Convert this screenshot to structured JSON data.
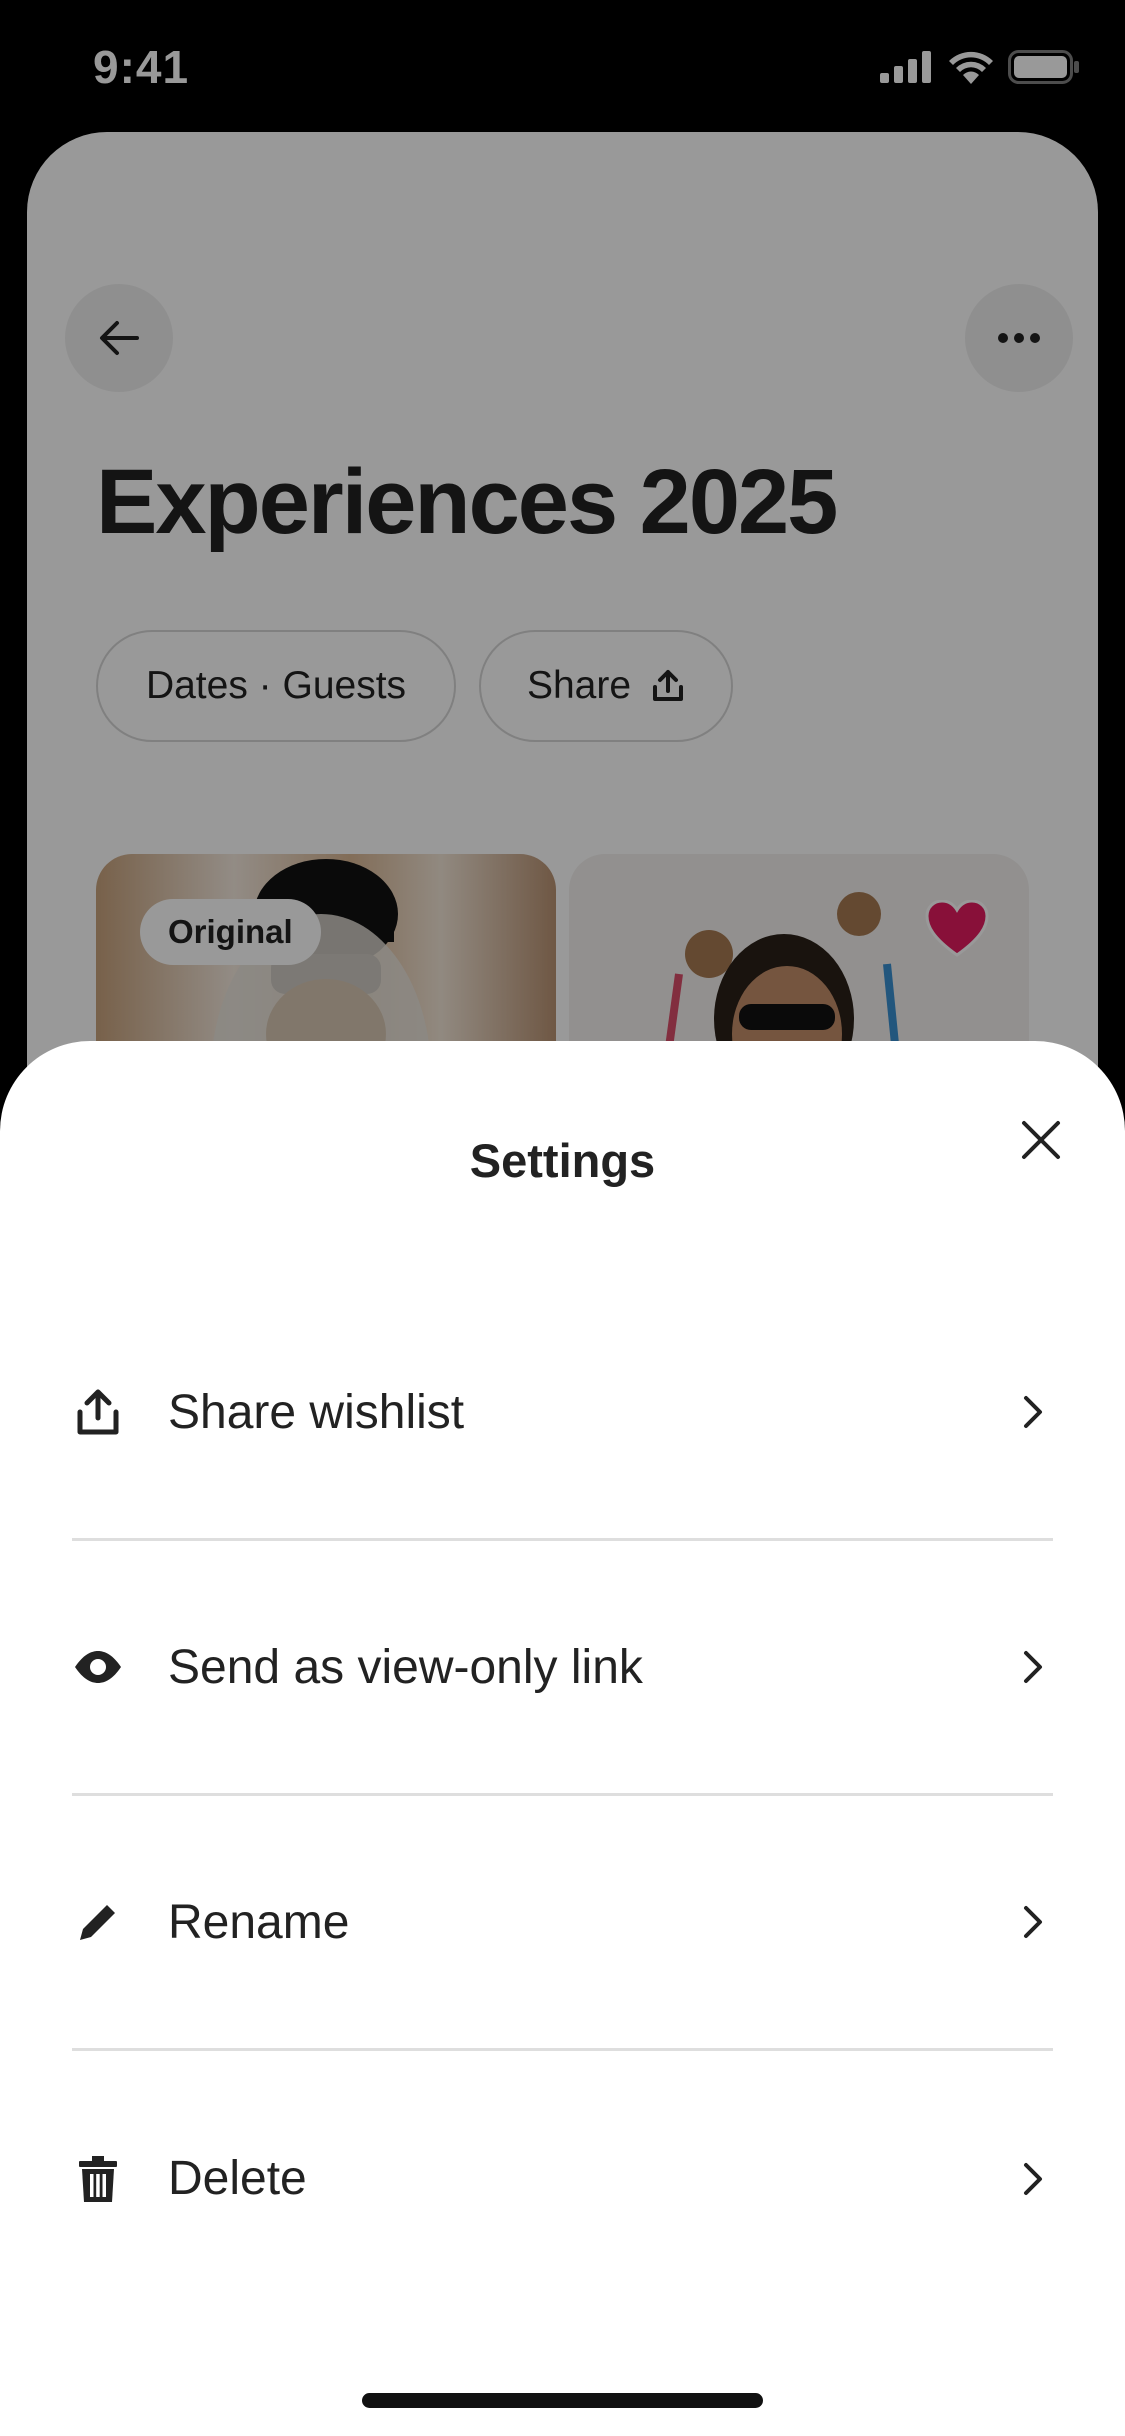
{
  "status_bar": {
    "time": "9:41"
  },
  "page": {
    "title": "Experiences 2025",
    "chips": {
      "dates_guests": "Dates · Guests",
      "share": "Share"
    },
    "cards": [
      {
        "badge": "Original"
      }
    ]
  },
  "sheet": {
    "title": "Settings",
    "items": [
      {
        "label": "Share wishlist",
        "icon": "share-icon"
      },
      {
        "label": "Send as view-only link",
        "icon": "eye-icon"
      },
      {
        "label": "Rename",
        "icon": "pencil-icon"
      },
      {
        "label": "Delete",
        "icon": "trash-icon"
      }
    ]
  },
  "colors": {
    "heart": "#e31c5f",
    "text": "#222222",
    "divider": "#dedede"
  }
}
